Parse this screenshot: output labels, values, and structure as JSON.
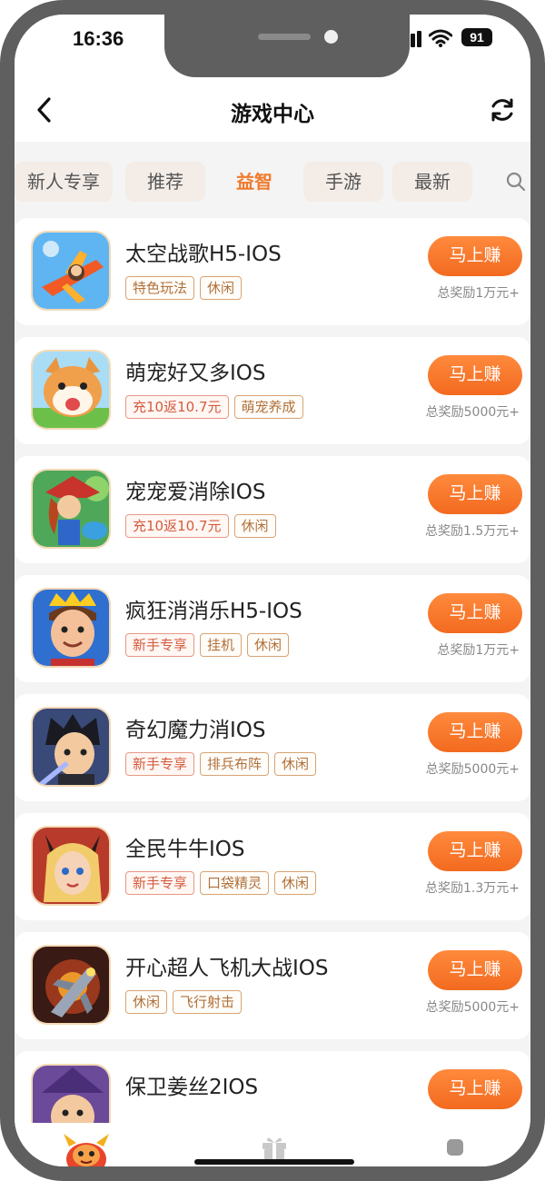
{
  "status": {
    "time": "16:36",
    "battery": "91"
  },
  "header": {
    "title": "游戏中心"
  },
  "tabs": [
    {
      "label": "新人专享",
      "active": false
    },
    {
      "label": "推荐",
      "active": false
    },
    {
      "label": "益智",
      "active": true
    },
    {
      "label": "手游",
      "active": false
    },
    {
      "label": "最新",
      "active": false
    }
  ],
  "games": [
    {
      "name": "太空战歌H5-IOS",
      "tags": [
        {
          "text": "特色玩法",
          "style": "brown"
        },
        {
          "text": "休闲",
          "style": "brown"
        }
      ],
      "button": "马上赚",
      "reward": "总奖励1万元+"
    },
    {
      "name": "萌宠好又多IOS",
      "tags": [
        {
          "text": "充10返10.7元",
          "style": "red"
        },
        {
          "text": "萌宠养成",
          "style": "brown"
        }
      ],
      "button": "马上赚",
      "reward": "总奖励5000元+"
    },
    {
      "name": "宠宠爱消除IOS",
      "tags": [
        {
          "text": "充10返10.7元",
          "style": "red"
        },
        {
          "text": "休闲",
          "style": "brown"
        }
      ],
      "button": "马上赚",
      "reward": "总奖励1.5万元+"
    },
    {
      "name": "疯狂消消乐H5-IOS",
      "tags": [
        {
          "text": "新手专享",
          "style": "red"
        },
        {
          "text": "挂机",
          "style": "brown"
        },
        {
          "text": "休闲",
          "style": "brown"
        }
      ],
      "button": "马上赚",
      "reward": "总奖励1万元+"
    },
    {
      "name": "奇幻魔力消IOS",
      "tags": [
        {
          "text": "新手专享",
          "style": "red"
        },
        {
          "text": "排兵布阵",
          "style": "brown"
        },
        {
          "text": "休闲",
          "style": "brown"
        }
      ],
      "button": "马上赚",
      "reward": "总奖励5000元+"
    },
    {
      "name": "全民牛牛IOS",
      "tags": [
        {
          "text": "新手专享",
          "style": "red"
        },
        {
          "text": "口袋精灵",
          "style": "brown"
        },
        {
          "text": "休闲",
          "style": "brown"
        }
      ],
      "button": "马上赚",
      "reward": "总奖励1.3万元+"
    },
    {
      "name": "开心超人飞机大战IOS",
      "tags": [
        {
          "text": "休闲",
          "style": "brown"
        },
        {
          "text": "飞行射击",
          "style": "brown"
        }
      ],
      "button": "马上赚",
      "reward": "总奖励5000元+"
    },
    {
      "name": "保卫姜丝2IOS",
      "tags": [],
      "button": "马上赚",
      "reward": ""
    }
  ],
  "icons": {
    "back": "back-arrow-icon",
    "refresh": "refresh-icon",
    "search": "search-icon",
    "gift": "gift-icon",
    "mascot": "mascot-icon"
  },
  "colors": {
    "accent": "#f26a1f",
    "tab_active": "#f07a2c",
    "tag_brown": "#b0703a",
    "tag_red": "#d55b3e"
  }
}
